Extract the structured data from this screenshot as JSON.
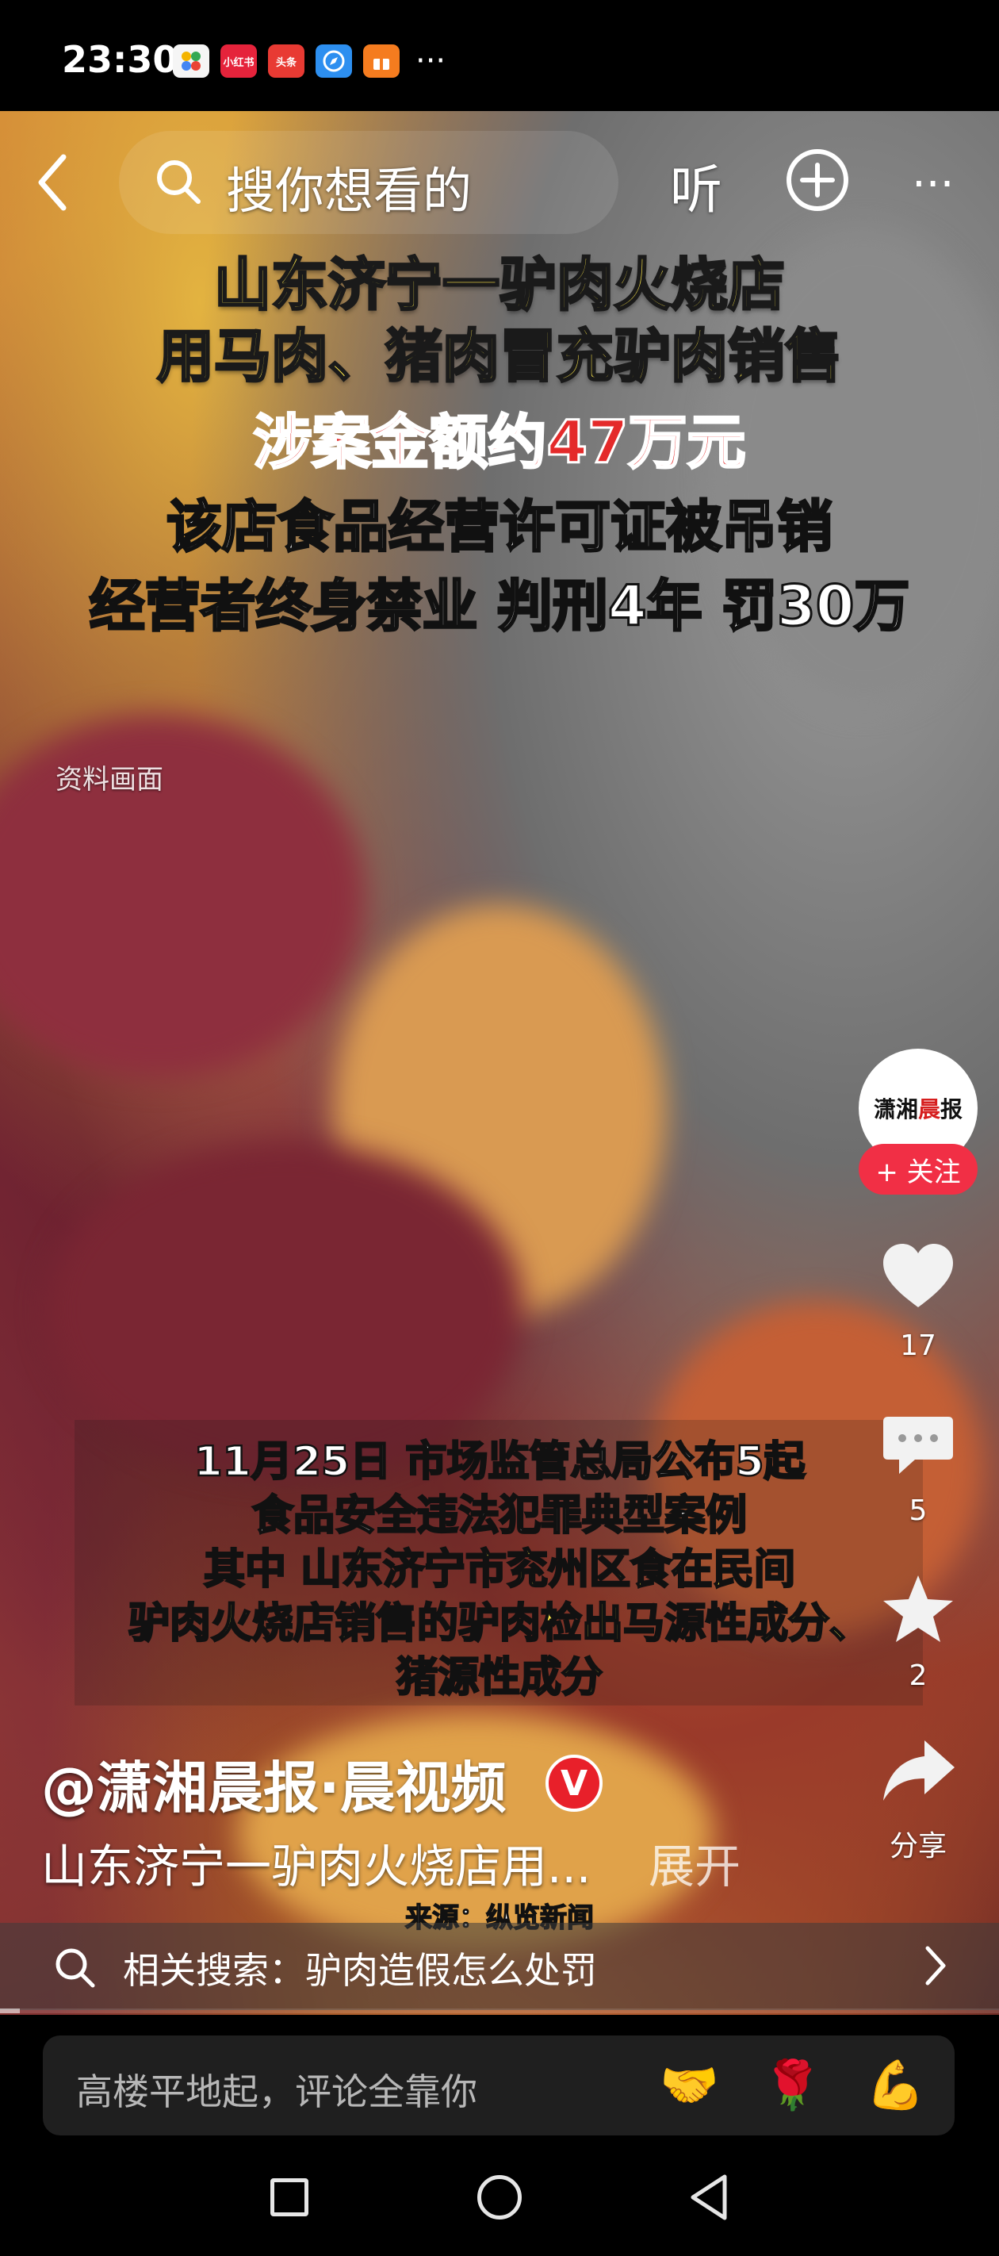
{
  "status_bar": {
    "time": "23:30",
    "app_icons": [
      {
        "name": "app-icon-1",
        "label": "",
        "color": "#f5f5f5"
      },
      {
        "name": "app-icon-2",
        "label": "小红书",
        "color": "#e5233b"
      },
      {
        "name": "app-icon-3",
        "label": "头条",
        "color": "#e83a33"
      },
      {
        "name": "app-icon-4",
        "label": "",
        "color": "#2d8ff0"
      },
      {
        "name": "app-icon-5",
        "label": "",
        "color": "#f57c1f"
      }
    ],
    "more": "···"
  },
  "top_nav": {
    "search_placeholder": "搜你想看的",
    "listen_label": "听",
    "more_label": "···"
  },
  "video": {
    "overlay_lines": [
      "山东济宁一驴肉火烧店",
      "用马肉、猪肉冒充驴肉销售",
      "涉案金额约47万元",
      "该店食品经营许可证被吊销",
      "经营者终身禁业 判刑4年 罚30万"
    ],
    "file_label": "资料画面",
    "caption_lines": [
      "11月25日 市场监管总局公布5起",
      "食品安全违法犯罪典型案例",
      "其中 山东济宁市兖州区食在民间",
      "驴肉火烧店销售的驴肉检出马源性成分、",
      "猪源性成分"
    ],
    "source": "来源：纵览新闻"
  },
  "right_rail": {
    "avatar_text_a": "潇湘",
    "avatar_text_b": "晨",
    "avatar_text_c": "报",
    "follow_label": "+ 关注",
    "like_count": "17",
    "comment_count": "5",
    "favorite_count": "2",
    "share_label": "分享"
  },
  "post": {
    "author": "@潇湘晨报·晨视频",
    "verified": "V",
    "description": "山东济宁一驴肉火烧店用...",
    "expand_label": "展开"
  },
  "related": {
    "text": "相关搜索：驴肉造假怎么处罚"
  },
  "progress": 0.02,
  "comment": {
    "placeholder": "高楼平地起，评论全靠你",
    "emojis": [
      "🤝",
      "🌹",
      "💪"
    ]
  }
}
